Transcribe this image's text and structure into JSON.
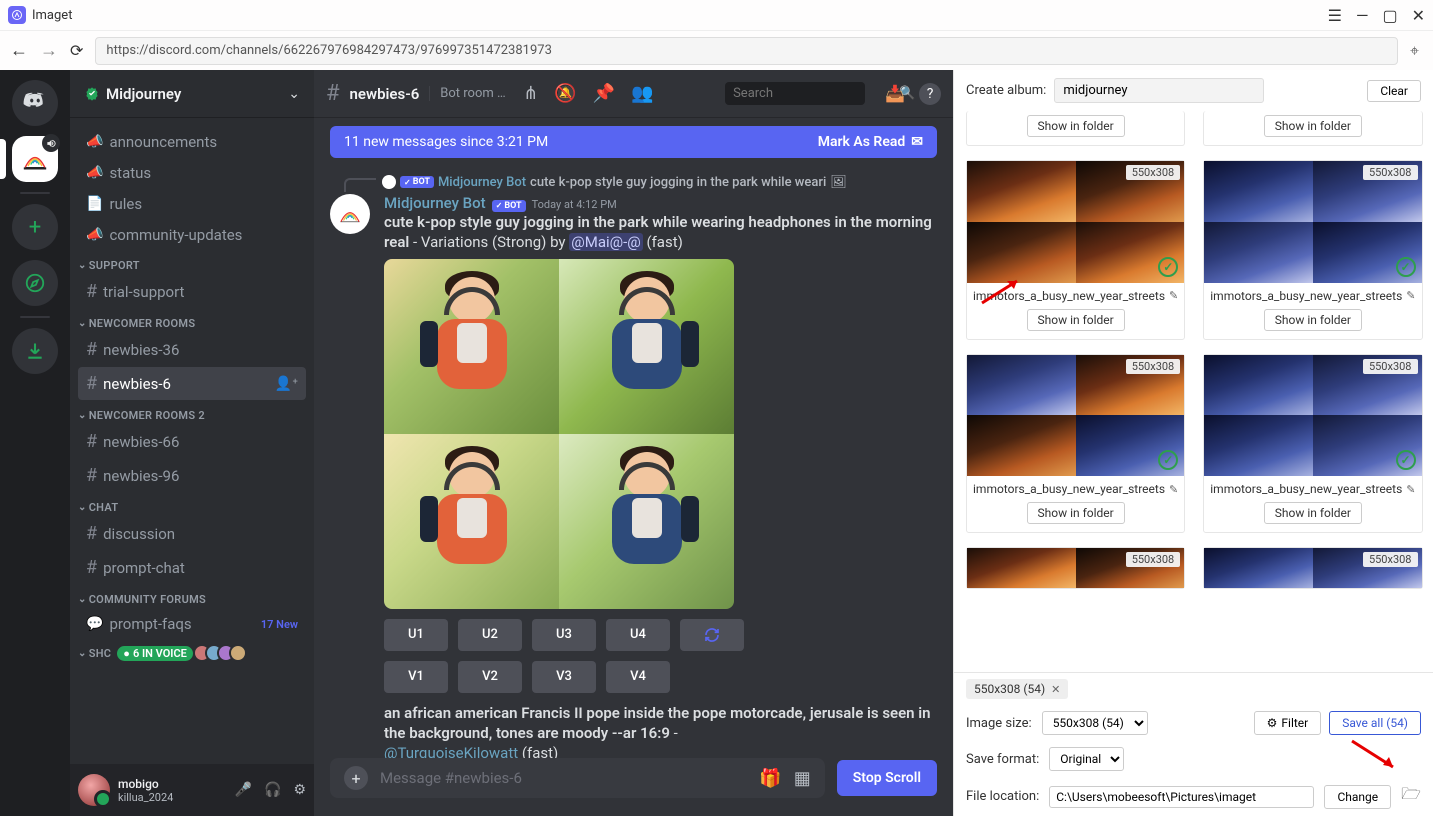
{
  "app": {
    "title": "Imaget"
  },
  "url": "https://discord.com/channels/662267976984297473/976997351472381973",
  "discord": {
    "server_name": "Midjourney",
    "channels": {
      "announcements": "announcements",
      "status": "status",
      "rules": "rules",
      "community_updates": "community-updates",
      "cat_support": "SUPPORT",
      "trial_support": "trial-support",
      "cat_newcomer": "NEWCOMER ROOMS",
      "newbies_36": "newbies-36",
      "newbies_6": "newbies-6",
      "cat_newcomer2": "NEWCOMER ROOMS 2",
      "newbies_66": "newbies-66",
      "newbies_96": "newbies-96",
      "cat_chat": "CHAT",
      "discussion": "discussion",
      "prompt_chat": "prompt-chat",
      "cat_forums": "COMMUNITY FORUMS",
      "prompt_faqs": "prompt-faqs",
      "prompt_faqs_new": "17 New",
      "cat_shc": "SHC",
      "voice_count": "6 IN VOICE"
    },
    "user": {
      "name": "mobigo",
      "tag": "killua_2024"
    },
    "chat": {
      "title": "newbies-6",
      "topic": "Bot room f...",
      "search_placeholder": "Search",
      "new_msgs": "11 new messages since 3:21 PM",
      "mark_read": "Mark As Read",
      "reply": {
        "bot_label": "BOT",
        "user": "Midjourney Bot",
        "text": "cute k-pop style guy jogging in the park while weari"
      },
      "message": {
        "author": "Midjourney Bot",
        "bot_label": "BOT",
        "time": "Today at 4:12 PM",
        "prompt_bold": "cute k-pop style guy jogging in the park while wearing headphones in the morning real",
        "suffix_plain": " - Variations (Strong) by ",
        "mention": "@Mai@-@",
        "suffix_end": " (fast)"
      },
      "buttons": {
        "u1": "U1",
        "u2": "U2",
        "u3": "U3",
        "u4": "U4",
        "v1": "V1",
        "v2": "V2",
        "v3": "V3",
        "v4": "V4"
      },
      "next_prompt_bold": "an african american Francis II pope inside the pope motorcade, jerusale is seen in the background, tones are moody --ar 16:9",
      "next_prompt_dash": " - ",
      "next_mention": "@TurquoiseKilowatt",
      "next_suffix": " (fast)",
      "input_placeholder": "Message #newbies-6",
      "stop_scroll": "Stop Scroll"
    }
  },
  "side": {
    "create_album_label": "Create album:",
    "album_value": "midjourney",
    "clear": "Clear",
    "thumb_tag": "550x308",
    "card_title": "immotors_a_busy_new_year_streets",
    "show_in_folder": "Show in folder",
    "chip": "550x308 (54)",
    "image_size_label": "Image size:",
    "image_size_value": "550x308 (54)",
    "filter_label": "Filter",
    "save_all_label": "Save all (54)",
    "save_format_label": "Save format:",
    "save_format_value": "Original",
    "file_location_label": "File location:",
    "file_location_value": "C:\\Users\\mobeesoft\\Pictures\\imaget",
    "change_label": "Change"
  }
}
